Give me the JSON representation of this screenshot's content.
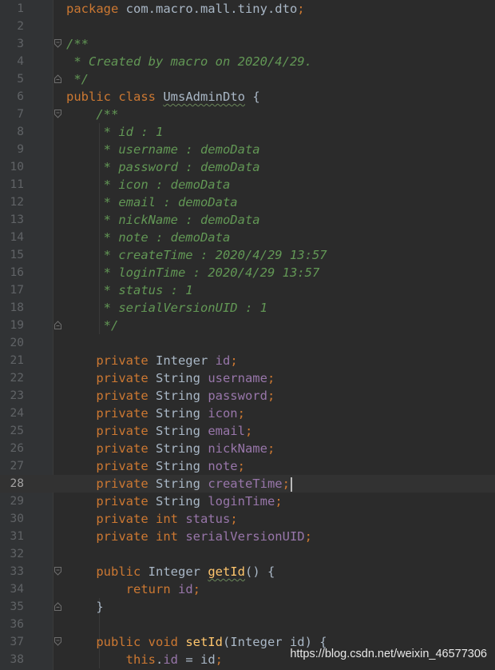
{
  "editor": {
    "current_line": 28,
    "lines": [
      {
        "n": "1",
        "tokens": [
          [
            "kw",
            "package"
          ],
          [
            "plain",
            " com.macro.mall.tiny.dto"
          ],
          [
            "punct",
            ";"
          ]
        ]
      },
      {
        "n": "2",
        "tokens": []
      },
      {
        "n": "3",
        "fold": "open",
        "tokens": [
          [
            "comment",
            "/**"
          ]
        ]
      },
      {
        "n": "4",
        "tokens": [
          [
            "comment",
            " * Created by macro on 2020/4/29."
          ]
        ]
      },
      {
        "n": "5",
        "fold": "close",
        "tokens": [
          [
            "comment",
            " */"
          ]
        ]
      },
      {
        "n": "6",
        "tokens": [
          [
            "kw",
            "public class "
          ],
          [
            "plainu",
            "UmsAdminDto"
          ],
          [
            "plain",
            " {"
          ]
        ]
      },
      {
        "n": "7",
        "fold": "open",
        "tokens": [
          [
            "comment",
            "    /**"
          ]
        ]
      },
      {
        "n": "8",
        "tokens": [
          [
            "comment",
            "     * id : 1"
          ]
        ]
      },
      {
        "n": "9",
        "tokens": [
          [
            "comment",
            "     * username : demoData"
          ]
        ]
      },
      {
        "n": "10",
        "tokens": [
          [
            "comment",
            "     * password : demoData"
          ]
        ]
      },
      {
        "n": "11",
        "tokens": [
          [
            "comment",
            "     * icon : demoData"
          ]
        ]
      },
      {
        "n": "12",
        "tokens": [
          [
            "comment",
            "     * email : demoData"
          ]
        ]
      },
      {
        "n": "13",
        "tokens": [
          [
            "comment",
            "     * nickName : demoData"
          ]
        ]
      },
      {
        "n": "14",
        "tokens": [
          [
            "comment",
            "     * note : demoData"
          ]
        ]
      },
      {
        "n": "15",
        "tokens": [
          [
            "comment",
            "     * createTime : 2020/4/29 13:57"
          ]
        ]
      },
      {
        "n": "16",
        "tokens": [
          [
            "comment",
            "     * loginTime : 2020/4/29 13:57"
          ]
        ]
      },
      {
        "n": "17",
        "tokens": [
          [
            "comment",
            "     * status : 1"
          ]
        ]
      },
      {
        "n": "18",
        "tokens": [
          [
            "comment",
            "     * serialVersionUID : 1"
          ]
        ]
      },
      {
        "n": "19",
        "fold": "close",
        "tokens": [
          [
            "comment",
            "     */"
          ]
        ]
      },
      {
        "n": "20",
        "tokens": []
      },
      {
        "n": "21",
        "tokens": [
          [
            "kw",
            "    private "
          ],
          [
            "plain",
            "Integer "
          ],
          [
            "field",
            "id"
          ],
          [
            "punct",
            ";"
          ]
        ]
      },
      {
        "n": "22",
        "tokens": [
          [
            "kw",
            "    private "
          ],
          [
            "plain",
            "String "
          ],
          [
            "field",
            "username"
          ],
          [
            "punct",
            ";"
          ]
        ]
      },
      {
        "n": "23",
        "tokens": [
          [
            "kw",
            "    private "
          ],
          [
            "plain",
            "String "
          ],
          [
            "field",
            "password"
          ],
          [
            "punct",
            ";"
          ]
        ]
      },
      {
        "n": "24",
        "tokens": [
          [
            "kw",
            "    private "
          ],
          [
            "plain",
            "String "
          ],
          [
            "field",
            "icon"
          ],
          [
            "punct",
            ";"
          ]
        ]
      },
      {
        "n": "25",
        "tokens": [
          [
            "kw",
            "    private "
          ],
          [
            "plain",
            "String "
          ],
          [
            "field",
            "email"
          ],
          [
            "punct",
            ";"
          ]
        ]
      },
      {
        "n": "26",
        "tokens": [
          [
            "kw",
            "    private "
          ],
          [
            "plain",
            "String "
          ],
          [
            "field",
            "nickName"
          ],
          [
            "punct",
            ";"
          ]
        ]
      },
      {
        "n": "27",
        "tokens": [
          [
            "kw",
            "    private "
          ],
          [
            "plain",
            "String "
          ],
          [
            "field",
            "note"
          ],
          [
            "punct",
            ";"
          ]
        ]
      },
      {
        "n": "28",
        "tokens": [
          [
            "kw",
            "    private "
          ],
          [
            "plain",
            "String "
          ],
          [
            "field",
            "createTime"
          ],
          [
            "punct",
            ";"
          ]
        ]
      },
      {
        "n": "29",
        "tokens": [
          [
            "kw",
            "    private "
          ],
          [
            "plain",
            "String "
          ],
          [
            "field",
            "loginTime"
          ],
          [
            "punct",
            ";"
          ]
        ]
      },
      {
        "n": "30",
        "tokens": [
          [
            "kw",
            "    private int "
          ],
          [
            "field",
            "status"
          ],
          [
            "punct",
            ";"
          ]
        ]
      },
      {
        "n": "31",
        "tokens": [
          [
            "kw",
            "    private int "
          ],
          [
            "field",
            "serialVersionUID"
          ],
          [
            "punct",
            ";"
          ]
        ]
      },
      {
        "n": "32",
        "tokens": []
      },
      {
        "n": "33",
        "fold": "open",
        "tokens": [
          [
            "kw",
            "    public "
          ],
          [
            "plain",
            "Integer "
          ],
          [
            "methodu",
            "getId"
          ],
          [
            "plain",
            "() {"
          ]
        ]
      },
      {
        "n": "34",
        "tokens": [
          [
            "kw",
            "        return "
          ],
          [
            "field",
            "id"
          ],
          [
            "punct",
            ";"
          ]
        ]
      },
      {
        "n": "35",
        "fold": "close",
        "tokens": [
          [
            "plain",
            "    }"
          ]
        ]
      },
      {
        "n": "36",
        "tokens": []
      },
      {
        "n": "37",
        "fold": "open",
        "tokens": [
          [
            "kw",
            "    public void "
          ],
          [
            "method",
            "setId"
          ],
          [
            "plain",
            "(Integer id) {"
          ]
        ]
      },
      {
        "n": "38",
        "tokens": [
          [
            "kw",
            "        this"
          ],
          [
            "plain",
            "."
          ],
          [
            "field",
            "id"
          ],
          [
            "plain",
            " = id"
          ],
          [
            "punct",
            ";"
          ]
        ]
      }
    ]
  },
  "watermark": "https://blog.csdn.net/weixin_46577306",
  "colors": {
    "background": "#2b2b2b",
    "gutter": "#313335",
    "keyword": "#cc7832",
    "comment": "#629755",
    "field": "#9876aa",
    "method": "#ffc66d",
    "plain": "#a9b7c6"
  }
}
